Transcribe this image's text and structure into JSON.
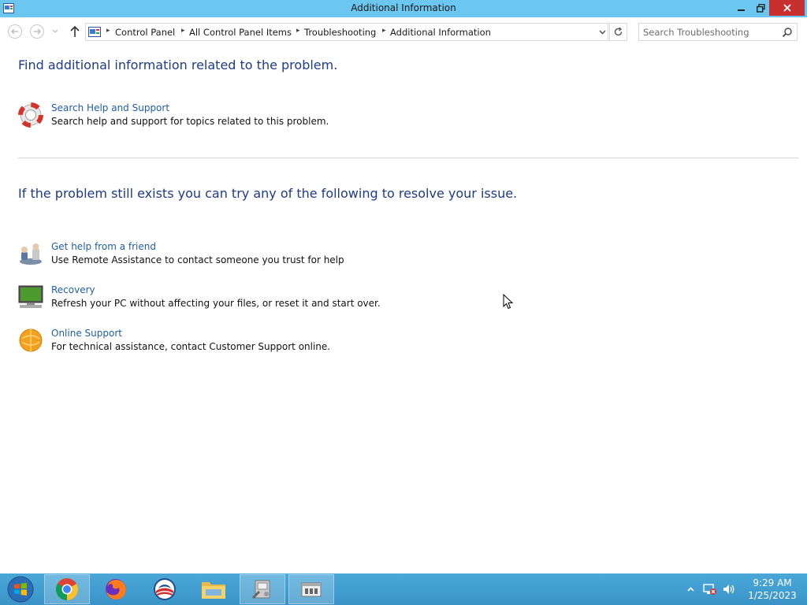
{
  "window": {
    "title": "Additional Information"
  },
  "navigation": {
    "breadcrumbs": [
      "Control Panel",
      "All Control Panel Items",
      "Troubleshooting",
      "Additional Information"
    ],
    "search_placeholder": "Search Troubleshooting"
  },
  "content": {
    "heading_top": "Find additional information related to the problem.",
    "search_help": {
      "link": "Search Help and Support",
      "description": "Search help and support for topics related to this problem."
    },
    "heading_bottom": "If the problem still exists you can try any of the following to resolve your issue.",
    "options": [
      {
        "link": "Get help from a friend",
        "description": "Use Remote Assistance to contact someone you trust for help",
        "icon": "remote-assistance-icon"
      },
      {
        "link": "Recovery",
        "description": "Refresh your PC without affecting your files, or reset it and start over.",
        "icon": "recovery-icon"
      },
      {
        "link": "Online Support",
        "description": "For technical assistance, contact Customer Support online.",
        "icon": "online-support-icon"
      }
    ]
  },
  "taskbar": {
    "apps": [
      "chrome-icon",
      "firefox-icon",
      "obama-logo-icon",
      "file-explorer-icon",
      "troubleshooting-icon",
      "control-panel-icon"
    ],
    "time": "9:29 AM",
    "date": "1/25/2023"
  },
  "colors": {
    "titlebar": "#6bc6f0",
    "close_button": "#c7302f",
    "heading": "#1e3a8a",
    "link": "#1e5fa8",
    "taskbar": "#3a93c8"
  }
}
